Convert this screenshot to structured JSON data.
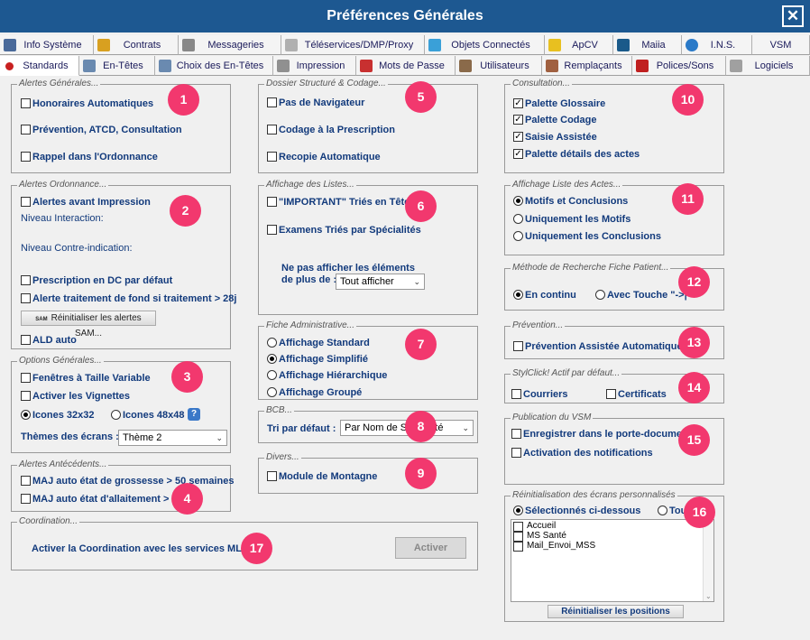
{
  "title": "Préférences Générales",
  "close_glyph": "✕",
  "tabs_row1": [
    {
      "label": "Info Système",
      "color": "#4a6a9a"
    },
    {
      "label": "Contrats",
      "color": "#d8a020"
    },
    {
      "label": "Messageries",
      "color": "#888888"
    },
    {
      "label": "Téléservices/DMP/Proxy",
      "color": "#b0b0b0"
    },
    {
      "label": "Objets Connectés",
      "color": "#3aa0d8"
    },
    {
      "label": "ApCV",
      "color": "#e8c020"
    },
    {
      "label": "Maiia",
      "color": "#1a5a8a"
    },
    {
      "label": "I.N.S.",
      "color": "#2a7ac8"
    },
    {
      "label": "VSM",
      "color": "#f4f4f4"
    }
  ],
  "tabs_row2": [
    {
      "label": "Standards",
      "color": "#c82020"
    },
    {
      "label": "En-Têtes",
      "color": "#6a8ab0"
    },
    {
      "label": "Choix des En-Têtes",
      "color": "#6a8ab0"
    },
    {
      "label": "Impression",
      "color": "#909090"
    },
    {
      "label": "Mots de Passe",
      "color": "#c83030"
    },
    {
      "label": "Utilisateurs",
      "color": "#8a6a4a"
    },
    {
      "label": "Remplaçants",
      "color": "#a06040"
    },
    {
      "label": "Polices/Sons",
      "color": "#c02020"
    },
    {
      "label": "Logiciels",
      "color": "#a0a0a0"
    }
  ],
  "groups": {
    "alertes_generales": {
      "title": "Alertes Générales...",
      "honoraires": "Honoraires Automatiques",
      "prevention": "Prévention, ATCD, Consultation",
      "rappel": "Rappel dans l'Ordonnance"
    },
    "alertes_ordonnance": {
      "title": "Alertes Ordonnance...",
      "avant_impression": "Alertes avant Impression",
      "niveau_interaction": "Niveau Interaction:",
      "niveau_ci": "Niveau Contre-indication:",
      "prescription_dc": "Prescription en DC par défaut",
      "traitement_fond": "Alerte traitement de fond si traitement  > 28j",
      "reinit_sam": "Réinitialiser les alertes SAM...",
      "sam_icon": "SAM",
      "ald": "ALD auto"
    },
    "options_generales": {
      "title": "Options Générales...",
      "fenetres": "Fenêtres à Taille Variable",
      "vignettes": "Activer les Vignettes",
      "icones32": "Icones 32x32",
      "icones48": "Icones 48x48",
      "help": "?",
      "themes_label": "Thèmes des écrans :",
      "theme_value": "Thème 2"
    },
    "alertes_antecedents": {
      "title": "Alertes Antécédents...",
      "grossesse": "MAJ auto état de grossesse > 50 semaines",
      "allaitement": "MAJ auto état d'allaitement > 3 ans"
    },
    "coordination": {
      "title": "Coordination...",
      "label": "Activer la Coordination avec les services MLM",
      "button": "Activer"
    },
    "dossier": {
      "title": "Dossier Structuré & Codage...",
      "navigateur": "Pas de Navigateur",
      "codage": "Codage à la Prescription",
      "recopie": "Recopie Automatique"
    },
    "affichage_listes": {
      "title": "Affichage des Listes...",
      "important": "\"IMPORTANT\" Triés en Tête",
      "examens": "Examens Triés par Spécialités",
      "ne_pas_line1": "Ne pas afficher les éléments",
      "ne_pas_line2": "de plus de :",
      "select_value": "Tout afficher"
    },
    "fiche_admin": {
      "title": "Fiche Administrative...",
      "standard": "Affichage Standard",
      "simplifie": "Affichage Simplifié",
      "hierarchique": "Affichage Hiérarchique",
      "groupe": "Affichage Groupé"
    },
    "bcb": {
      "title": "BCB...",
      "tri_label": "Tri par défaut :",
      "tri_value": "Par Nom de Spécialité"
    },
    "divers": {
      "title": "Divers...",
      "montagne": "Module de Montagne"
    },
    "consultation": {
      "title": "Consultation...",
      "glossaire": "Palette Glossaire",
      "codage": "Palette Codage",
      "saisie": "Saisie Assistée",
      "details": "Palette détails des actes"
    },
    "affichage_actes": {
      "title": "Affichage Liste des Actes...",
      "motifs_conclusions": "Motifs et Conclusions",
      "motifs": "Uniquement les Motifs",
      "conclusions": "Uniquement les Conclusions"
    },
    "recherche": {
      "title": "Méthode de Recherche Fiche Patient...",
      "continu": "En continu",
      "touche": "Avec Touche \"->|\""
    },
    "prevention": {
      "title": "Prévention...",
      "assistee": "Prévention Assistée Automatique"
    },
    "styl": {
      "title": "StylClick! Actif par défaut...",
      "courriers": "Courriers",
      "certificats": "Certificats"
    },
    "vsm": {
      "title": "Publication du VSM",
      "enregistrer": "Enregistrer dans le porte-document",
      "activation": "Activation des notifications"
    },
    "reinit": {
      "title": "Réinitialisation des écrans personnalisés",
      "selectionnes": "Sélectionnés ci-dessous",
      "tous": "Tous",
      "items": [
        "Accueil",
        "MS Santé",
        "Mail_Envoi_MSS"
      ],
      "button": "Réinitialiser les positions"
    }
  },
  "badges": [
    "1",
    "2",
    "3",
    "4",
    "5",
    "6",
    "7",
    "8",
    "9",
    "10",
    "11",
    "12",
    "13",
    "14",
    "15",
    "16",
    "17"
  ],
  "check_mark": "✓",
  "arrow_glyph": "⌄"
}
